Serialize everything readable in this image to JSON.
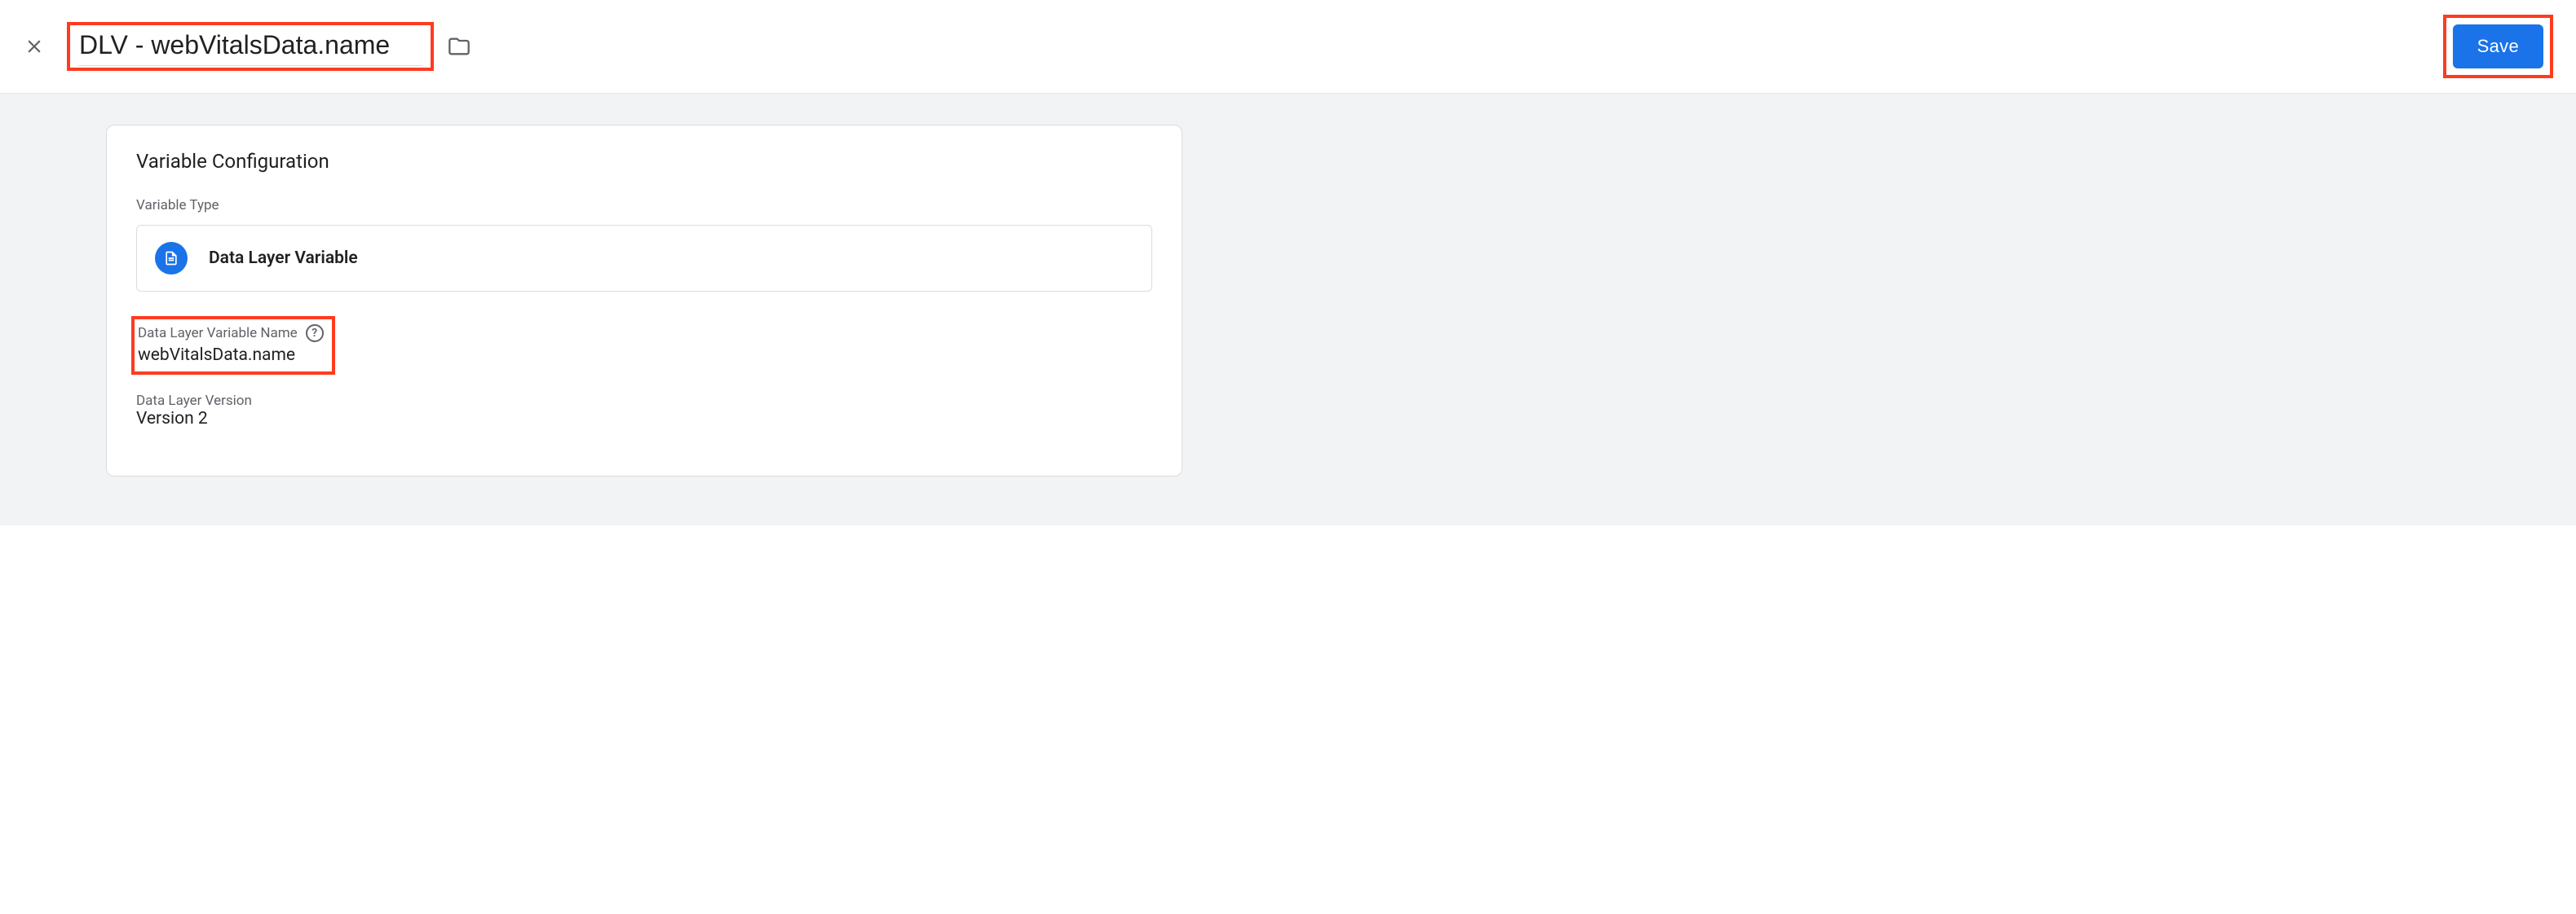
{
  "header": {
    "variable_name": "DLV - webVitalsData.name",
    "save_label": "Save"
  },
  "card": {
    "title": "Variable Configuration",
    "type_label": "Variable Type",
    "type_value": "Data Layer Variable",
    "dlv_name_label": "Data Layer Variable Name",
    "dlv_name_value": "webVitalsData.name",
    "version_label": "Data Layer Version",
    "version_value": "Version 2"
  },
  "icons": {
    "close": "close-icon",
    "folder": "folder-icon",
    "file": "file-icon",
    "help": "help-icon"
  },
  "colors": {
    "accent": "#1a73e8",
    "highlight": "#ff3b1f",
    "muted": "#5f6368",
    "border": "#dadce0",
    "body_bg": "#f1f3f4"
  }
}
